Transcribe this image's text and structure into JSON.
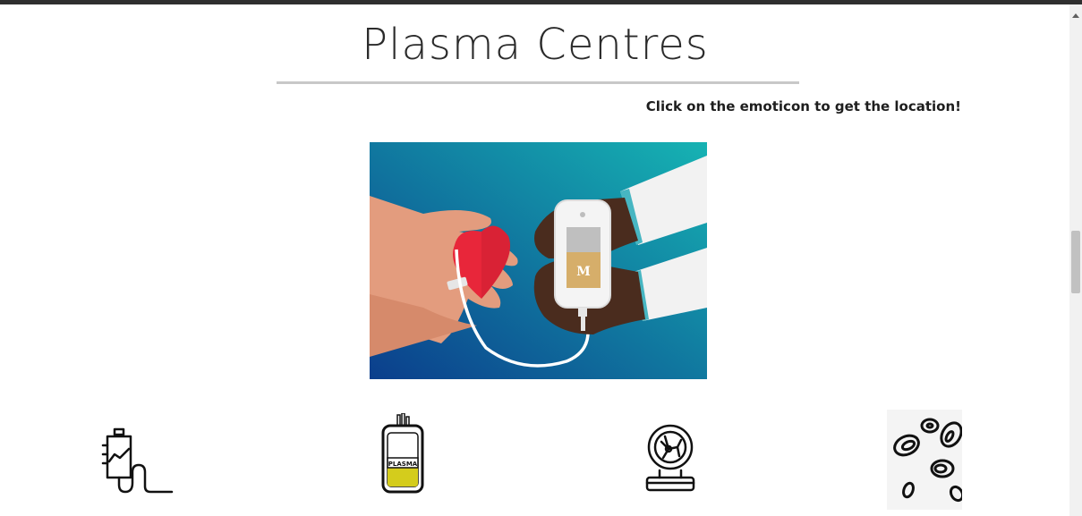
{
  "page": {
    "title": "Plasma Centres",
    "instruction": "Click on the emoticon to get the location!"
  },
  "hero_image": {
    "icon": "plasma-donation-illustration",
    "bag_letter": "M"
  },
  "emoticons": [
    {
      "icon": "iv-drip-icon"
    },
    {
      "icon": "plasma-bag-icon",
      "label": "PLASMA"
    },
    {
      "icon": "cell-globe-icon"
    },
    {
      "icon": "blood-cells-icon"
    }
  ],
  "colors": {
    "heart_red": "#e8263a",
    "plasma_yellow": "#d4cc1c",
    "hero_gradient_start": "#0b3e8c",
    "hero_gradient_end": "#16b3b3"
  }
}
